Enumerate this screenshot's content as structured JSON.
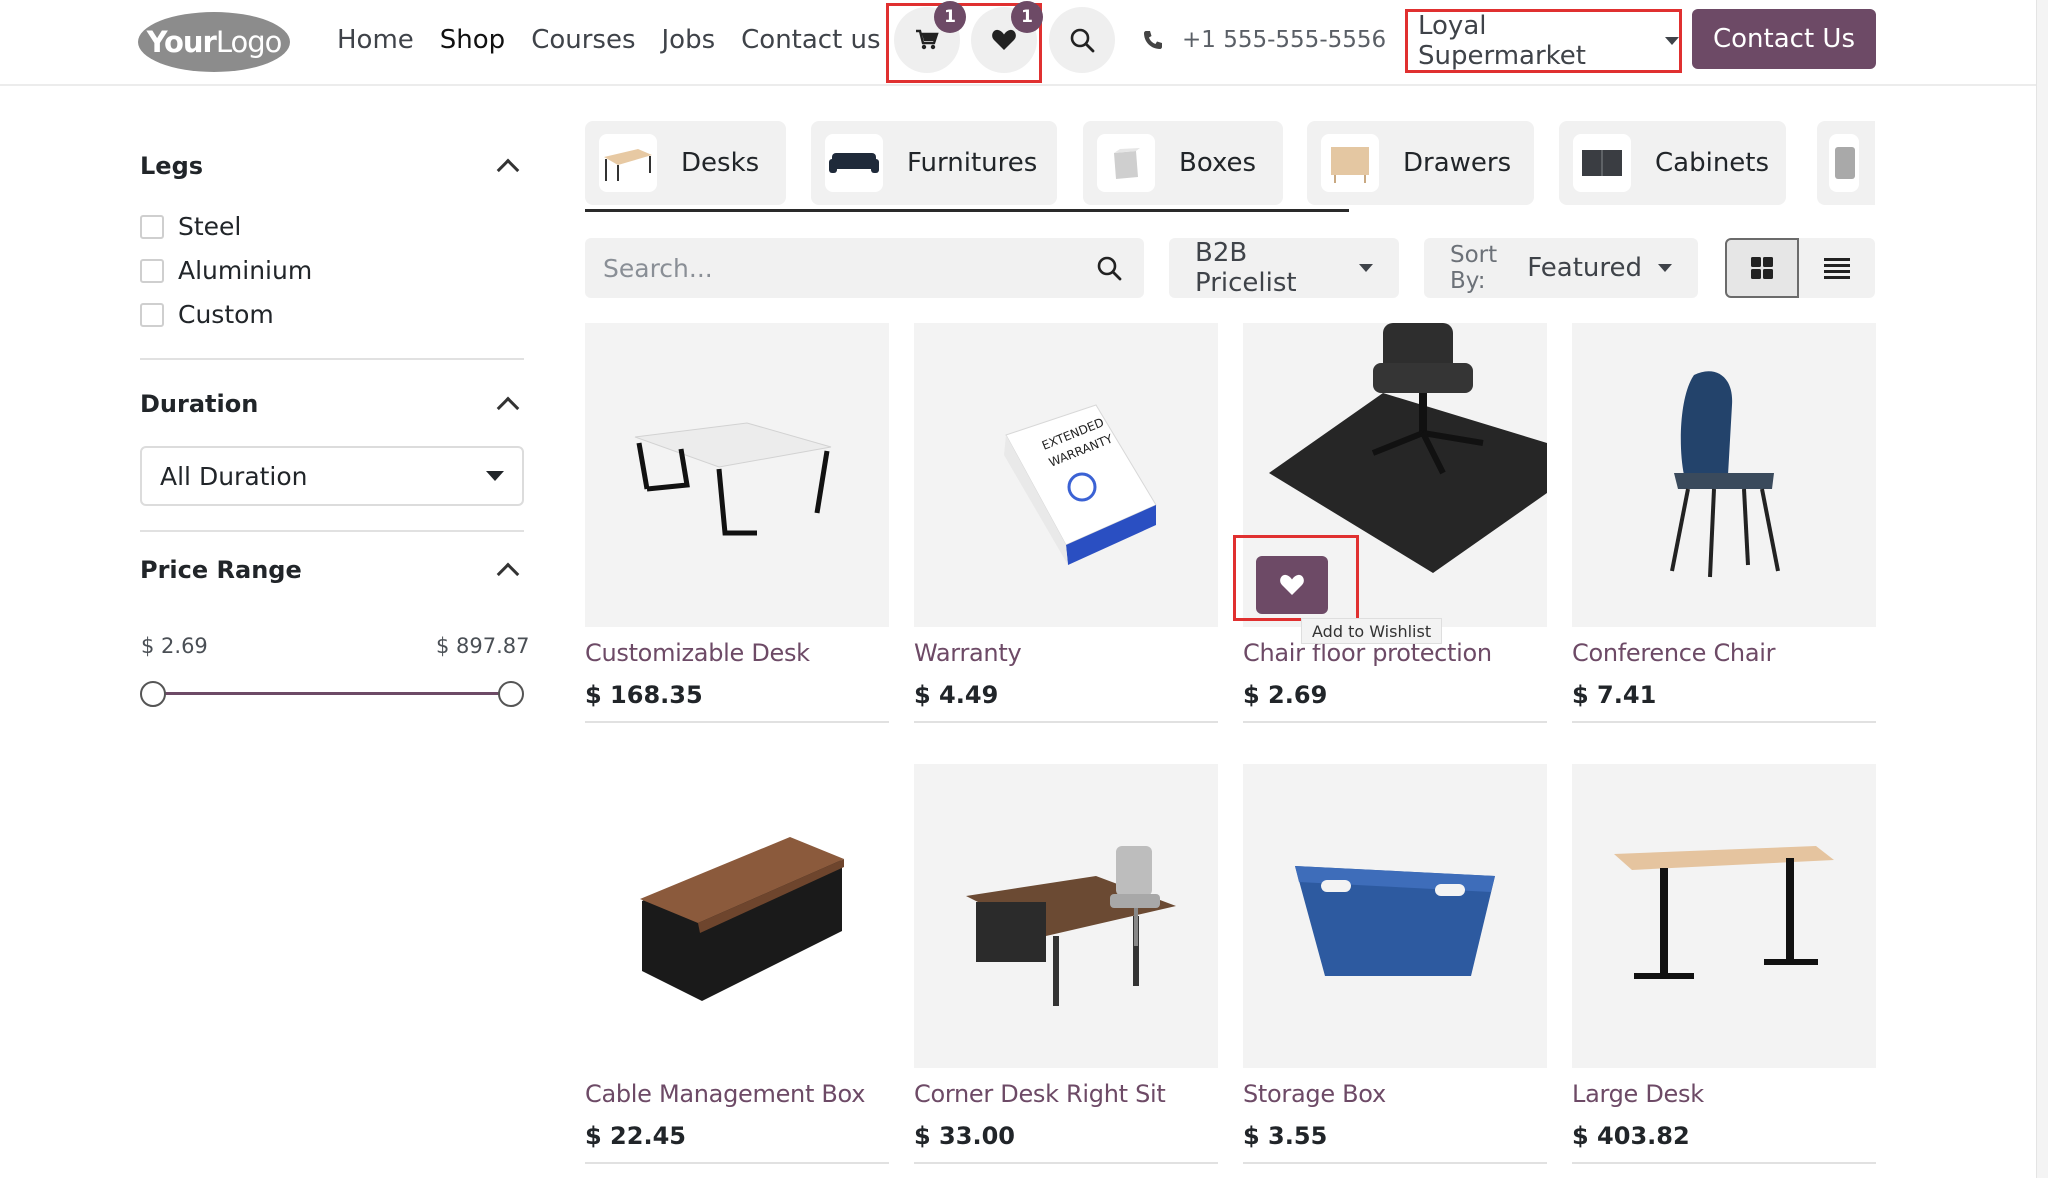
{
  "header": {
    "logo_text_bold": "Your",
    "logo_text_light": "Logo",
    "nav": [
      "Home",
      "Shop",
      "Courses",
      "Jobs",
      "Contact us"
    ],
    "active_nav": "Shop",
    "cart_count": "1",
    "wishlist_count": "1",
    "phone": "+1 555-555-5556",
    "pricelist_label": "Loyal Supermarket",
    "contact_button": "Contact Us",
    "icons": [
      "cart-icon",
      "heart-icon",
      "search-icon",
      "phone-icon",
      "caret-down-icon"
    ]
  },
  "sidebar": {
    "legs": {
      "title": "Legs",
      "options": [
        "Steel",
        "Aluminium",
        "Custom"
      ]
    },
    "duration": {
      "title": "Duration",
      "selected": "All Duration"
    },
    "price_range": {
      "title": "Price Range",
      "min": "$ 2.69",
      "max": "$ 897.87"
    }
  },
  "categories": [
    "Desks",
    "Furnitures",
    "Boxes",
    "Drawers",
    "Cabinets"
  ],
  "toolbar": {
    "search_placeholder": "Search...",
    "pricelist": "B2B Pricelist",
    "sort_prefix": "Sort By:",
    "sort_value": "Featured",
    "view_modes": [
      "grid-view-icon",
      "list-view-icon"
    ],
    "active_view": "grid"
  },
  "products": [
    {
      "name": "Customizable Desk",
      "price": "$ 168.35"
    },
    {
      "name": "Warranty",
      "price": "$ 4.49"
    },
    {
      "name": "Chair floor protection",
      "price": "$ 2.69"
    },
    {
      "name": "Conference Chair",
      "price": "$ 7.41"
    },
    {
      "name": "Cable Management Box",
      "price": "$ 22.45"
    },
    {
      "name": "Corner Desk Right Sit",
      "price": "$ 33.00"
    },
    {
      "name": "Storage Box",
      "price": "$ 3.55"
    },
    {
      "name": "Large Desk",
      "price": "$ 403.82"
    }
  ],
  "warranty_box_text": [
    "EXTENDED",
    "WARRANTY"
  ],
  "wishlist_tooltip": "Add to Wishlist",
  "colors": {
    "brand": "#6d4a66",
    "highlight_box": "#e03030"
  }
}
